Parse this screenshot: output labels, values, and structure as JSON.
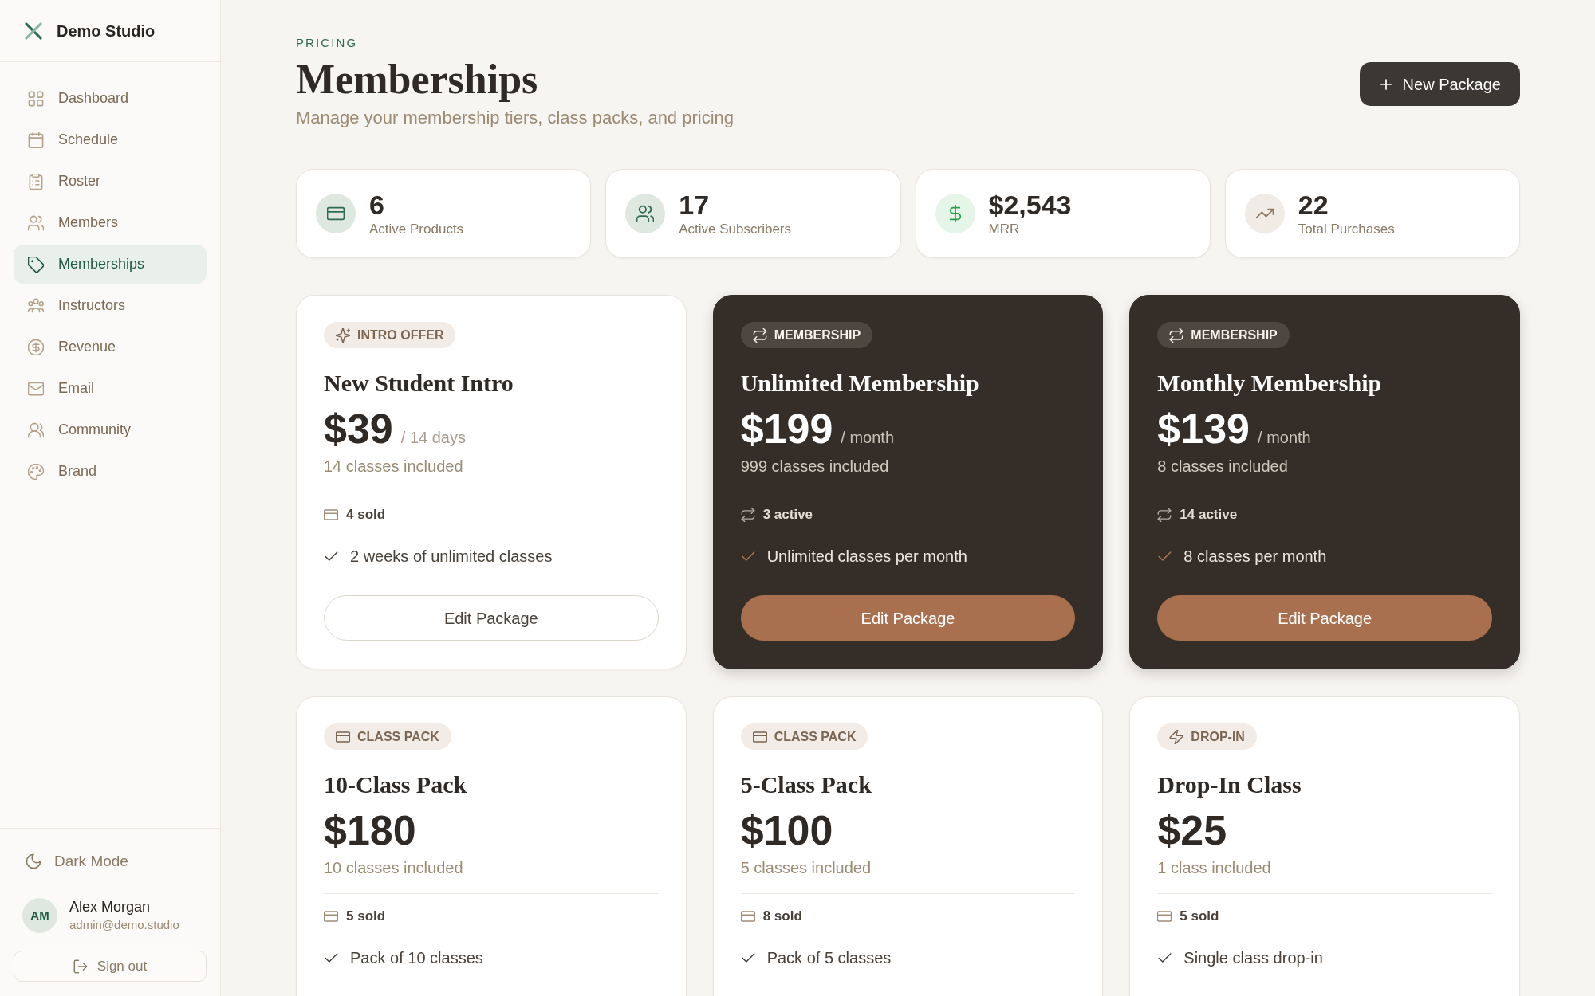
{
  "sidebar": {
    "brand": "Demo Studio",
    "nav": [
      {
        "label": "Dashboard",
        "selected": false
      },
      {
        "label": "Schedule",
        "selected": false
      },
      {
        "label": "Roster",
        "selected": false
      },
      {
        "label": "Members",
        "selected": false
      },
      {
        "label": "Memberships",
        "selected": true
      },
      {
        "label": "Instructors",
        "selected": false
      },
      {
        "label": "Revenue",
        "selected": false
      },
      {
        "label": "Email",
        "selected": false
      },
      {
        "label": "Community",
        "selected": false
      },
      {
        "label": "Brand",
        "selected": false
      }
    ],
    "dark_mode": "Dark Mode",
    "user": {
      "initials": "AM",
      "name": "Alex Morgan",
      "email": "admin@demo.studio"
    },
    "sign_out": "Sign out"
  },
  "header": {
    "eyebrow": "PRICING",
    "title": "Memberships",
    "subtitle": "Manage your membership tiers, class packs, and pricing",
    "action": "New Package"
  },
  "stats": [
    {
      "value": "6",
      "label": "Active Products"
    },
    {
      "value": "17",
      "label": "Active Subscribers"
    },
    {
      "value": "$2,543",
      "label": "MRR"
    },
    {
      "value": "22",
      "label": "Total Purchases"
    }
  ],
  "packages": [
    {
      "kind": "intro",
      "badge": "INTRO OFFER",
      "name": "New Student Intro",
      "price": "$39",
      "period": "/ 14 days",
      "included": "14 classes included",
      "count": "4 sold",
      "features": [
        "2 weeks of unlimited classes"
      ],
      "button": "Edit Package"
    },
    {
      "kind": "membership",
      "badge": "MEMBERSHIP",
      "name": "Unlimited Membership",
      "price": "$199",
      "period": "/ month",
      "included": "999 classes included",
      "count": "3 active",
      "features": [
        "Unlimited classes per month"
      ],
      "button": "Edit Package"
    },
    {
      "kind": "membership",
      "badge": "MEMBERSHIP",
      "name": "Monthly Membership",
      "price": "$139",
      "period": "/ month",
      "included": "8 classes included",
      "count": "14 active",
      "features": [
        "8 classes per month"
      ],
      "button": "Edit Package"
    },
    {
      "kind": "pack",
      "badge": "CLASS PACK",
      "name": "10-Class Pack",
      "price": "$180",
      "included": "10 classes included",
      "count": "5 sold",
      "features": [
        "Pack of 10 classes"
      ]
    },
    {
      "kind": "pack",
      "badge": "CLASS PACK",
      "name": "5-Class Pack",
      "price": "$100",
      "included": "5 classes included",
      "count": "8 sold",
      "features": [
        "Pack of 5 classes"
      ]
    },
    {
      "kind": "drop_in",
      "badge": "DROP-IN",
      "name": "Drop-In Class",
      "price": "$25",
      "included": "1 class included",
      "count": "5 sold",
      "features": [
        "Single class drop-in"
      ]
    }
  ]
}
